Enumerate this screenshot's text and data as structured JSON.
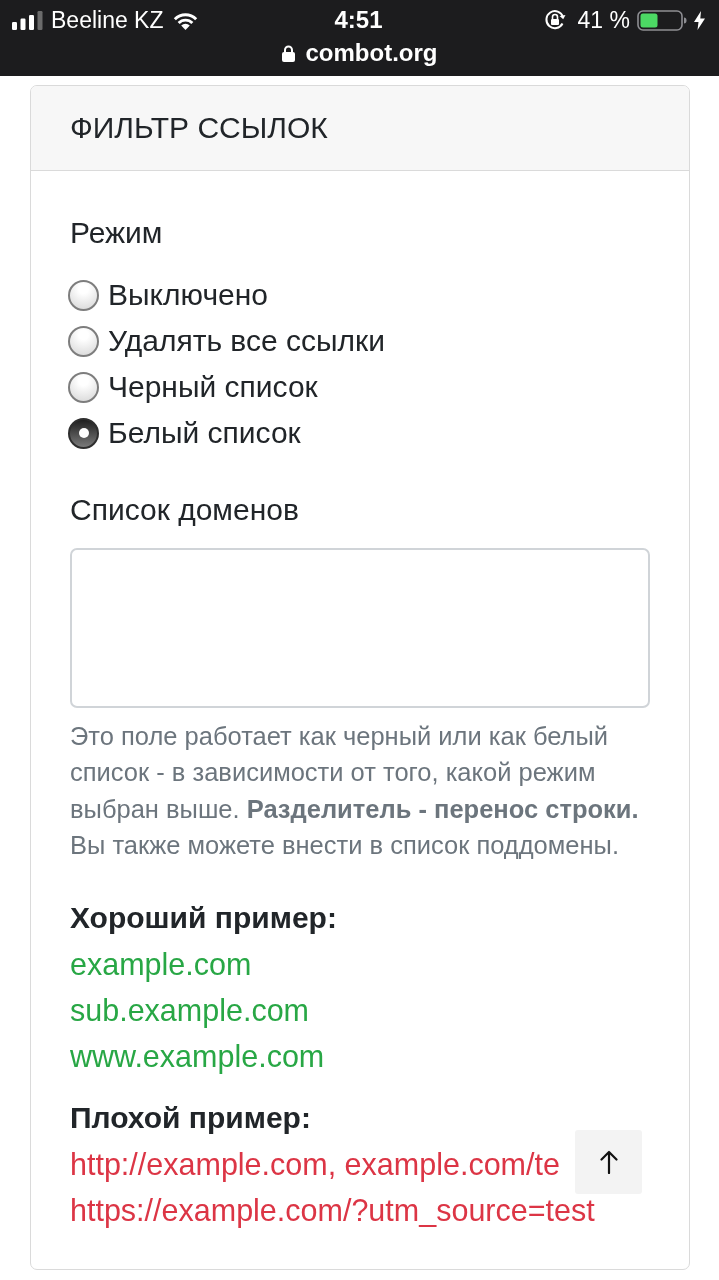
{
  "status_bar": {
    "carrier": "Beeline KZ",
    "time": "4:51",
    "battery_percent": "41 %"
  },
  "address_bar": {
    "url": "combot.org"
  },
  "card": {
    "title": "ФИЛЬТР ССЫЛОК",
    "mode": {
      "label": "Режим",
      "options": [
        {
          "label": "Выключено",
          "selected": false
        },
        {
          "label": "Удалять все ссылки",
          "selected": false
        },
        {
          "label": "Черный список",
          "selected": false
        },
        {
          "label": "Белый список",
          "selected": true
        }
      ]
    },
    "domains": {
      "label": "Список доменов",
      "help": "Это поле работает как черный или как белый список - в зависимости от того, какой режим выбран выше. **Разделитель - перенос строки.** Вы также можете внести в список поддомены."
    },
    "examples": [
      {
        "kind": "good",
        "title": "Хороший пример:",
        "items": [
          "example.com",
          "sub.example.com",
          "www.example.com"
        ]
      },
      {
        "kind": "bad",
        "title": "Плохой пример:",
        "items": [
          "http://example.com, example.com/te",
          "https://example.com/?utm_source=test"
        ]
      }
    ]
  }
}
